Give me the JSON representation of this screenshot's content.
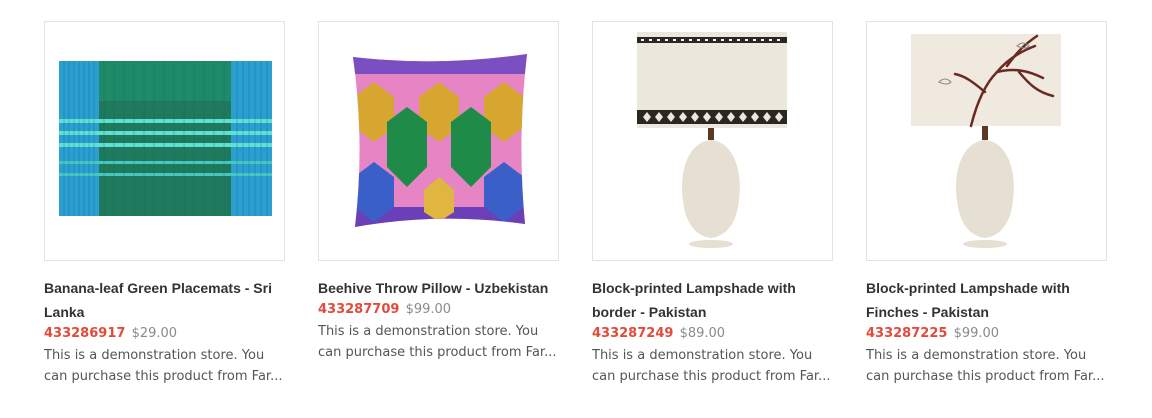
{
  "products": [
    {
      "title": "Banana-leaf Green Placemats - Sri Lanka",
      "sku": "433286917",
      "price": "$29.00",
      "description": "This is a demonstration store. You can purchase this product from Far...",
      "image_icon": "placemat-image"
    },
    {
      "title": "Beehive Throw Pillow - Uzbekistan",
      "sku": "433287709",
      "price": "$99.00",
      "description": "This is a demonstration store. You can purchase this product from Far...",
      "image_icon": "pillow-image"
    },
    {
      "title": "Block-printed Lampshade with border - Pakistan",
      "sku": "433287249",
      "price": "$89.00",
      "description": "This is a demonstration store. You can purchase this product from Far...",
      "image_icon": "lamp-border-image"
    },
    {
      "title": "Block-printed Lampshade with Finches - Pakistan",
      "sku": "433287225",
      "price": "$99.00",
      "description": "This is a demonstration store. You can purchase this product from Far...",
      "image_icon": "lamp-finches-image"
    }
  ],
  "colors": {
    "sku": "#e24b3b",
    "price": "#8a8a8a",
    "title": "#333333"
  }
}
